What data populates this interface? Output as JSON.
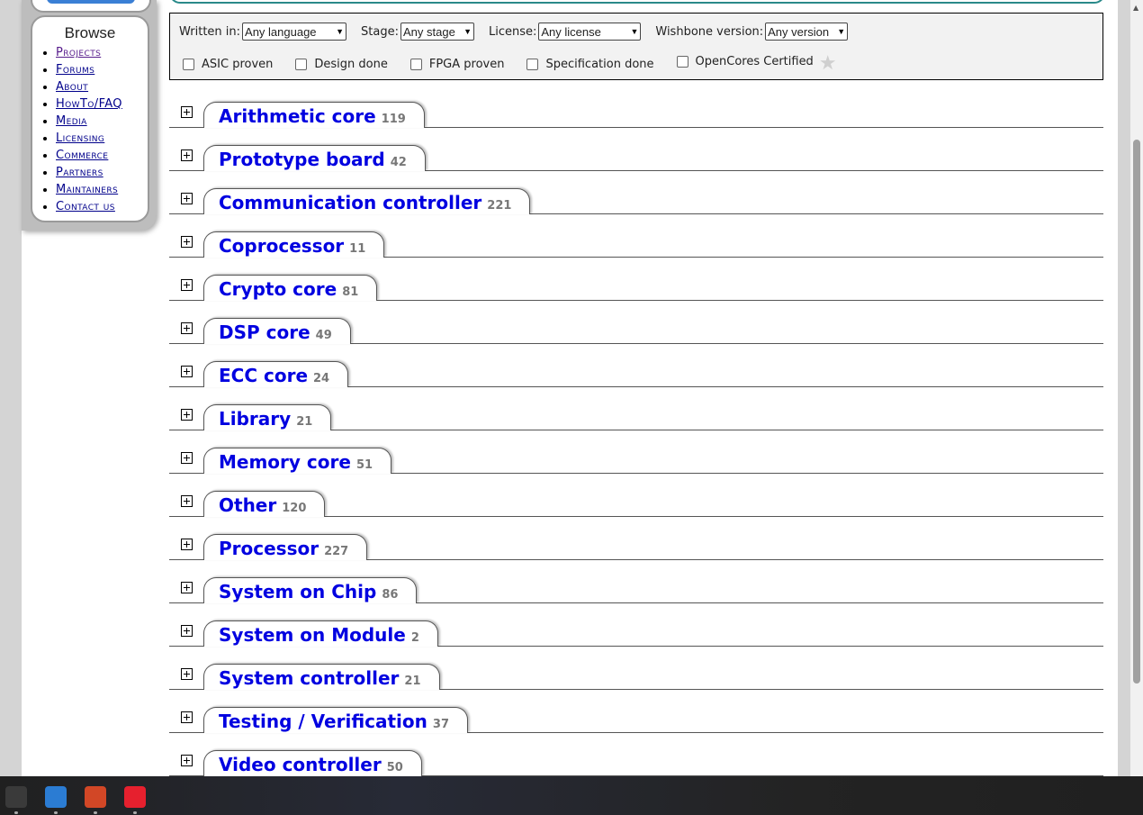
{
  "sidebar": {
    "title": "Browse",
    "items": [
      {
        "label": "Projects",
        "visited": true
      },
      {
        "label": "Forums"
      },
      {
        "label": "About"
      },
      {
        "label": "HowTo/FAQ"
      },
      {
        "label": "Media"
      },
      {
        "label": "Licensing"
      },
      {
        "label": "Commerce"
      },
      {
        "label": "Partners"
      },
      {
        "label": "Maintainers"
      },
      {
        "label": "Contact us"
      }
    ]
  },
  "filters": {
    "written_in": {
      "label": "Written in:",
      "value": "Any language"
    },
    "stage": {
      "label": "Stage:",
      "value": "Any stage"
    },
    "license": {
      "label": "License:",
      "value": "Any license"
    },
    "wishbone": {
      "label": "Wishbone version:",
      "value": "Any version"
    },
    "checkboxes": [
      "ASIC proven",
      "Design done",
      "FPGA proven",
      "Specification done",
      "OpenCores Certified"
    ]
  },
  "categories": [
    {
      "name": "Arithmetic core",
      "count": "119"
    },
    {
      "name": "Prototype board",
      "count": "42"
    },
    {
      "name": "Communication controller",
      "count": "221"
    },
    {
      "name": "Coprocessor",
      "count": "11"
    },
    {
      "name": "Crypto core",
      "count": "81"
    },
    {
      "name": "DSP core",
      "count": "49"
    },
    {
      "name": "ECC core",
      "count": "24"
    },
    {
      "name": "Library",
      "count": "21"
    },
    {
      "name": "Memory core",
      "count": "51"
    },
    {
      "name": "Other",
      "count": "120"
    },
    {
      "name": "Processor",
      "count": "227"
    },
    {
      "name": "System on Chip",
      "count": "86"
    },
    {
      "name": "System on Module",
      "count": "2"
    },
    {
      "name": "System controller",
      "count": "21"
    },
    {
      "name": "Testing / Verification",
      "count": "37"
    },
    {
      "name": "Video controller",
      "count": "50"
    }
  ],
  "taskbar": {
    "apps": [
      {
        "icon": "terminal-icon",
        "color": "#3a3a3a"
      },
      {
        "icon": "todo-check-icon",
        "color": "#2b7cd3"
      },
      {
        "icon": "powerpoint-icon",
        "color": "#d24726"
      },
      {
        "icon": "netease-music-icon",
        "color": "#e6202e"
      }
    ]
  }
}
